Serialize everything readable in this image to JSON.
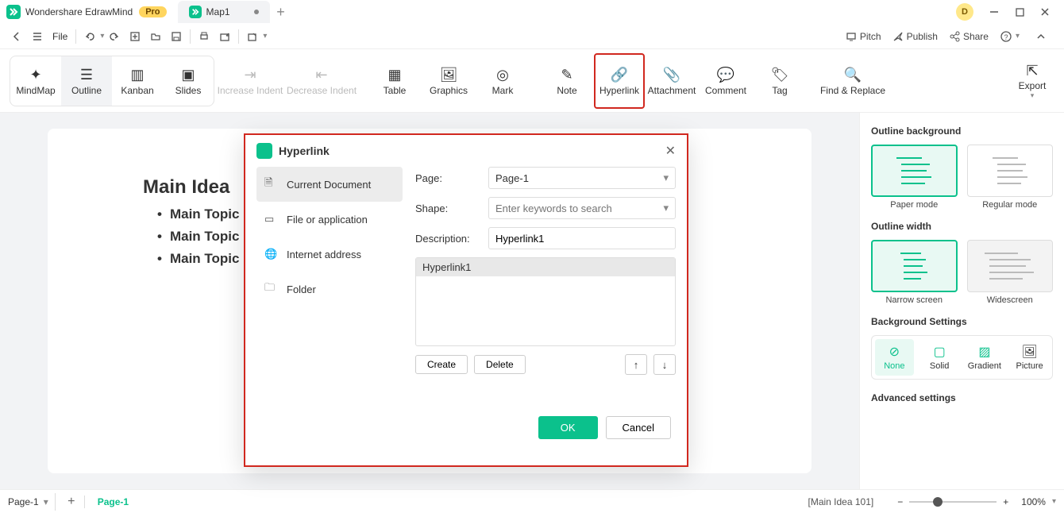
{
  "app": {
    "name": "Wondershare EdrawMind",
    "badge": "Pro",
    "user_initial": "D"
  },
  "tabs": {
    "active": "Map1"
  },
  "menu": {
    "file": "File"
  },
  "toolbar_right": {
    "pitch": "Pitch",
    "publish": "Publish",
    "share": "Share"
  },
  "ribbon": {
    "views": {
      "mindmap": "MindMap",
      "outline": "Outline",
      "kanban": "Kanban",
      "slides": "Slides"
    },
    "indent_in": "Increase Indent",
    "indent_out": "Decrease Indent",
    "table": "Table",
    "graphics": "Graphics",
    "mark": "Mark",
    "note": "Note",
    "hyperlink": "Hyperlink",
    "attachment": "Attachment",
    "comment": "Comment",
    "tag": "Tag",
    "find": "Find & Replace",
    "export": "Export"
  },
  "document": {
    "main_idea": "Main Idea",
    "topics": [
      "Main Topic",
      "Main Topic",
      "Main Topic"
    ]
  },
  "dialog": {
    "title": "Hyperlink",
    "nav": {
      "current": "Current Document",
      "file": "File or application",
      "internet": "Internet address",
      "folder": "Folder"
    },
    "labels": {
      "page": "Page:",
      "shape": "Shape:",
      "description": "Description:"
    },
    "page_value": "Page-1",
    "shape_placeholder": "Enter keywords to search",
    "description_value": "Hyperlink1",
    "list_item": "Hyperlink1",
    "create": "Create",
    "delete": "Delete",
    "ok": "OK",
    "cancel": "Cancel"
  },
  "side": {
    "outline_bg": "Outline background",
    "paper": "Paper mode",
    "regular": "Regular mode",
    "outline_width": "Outline width",
    "narrow": "Narrow screen",
    "wide": "Widescreen",
    "bg_settings": "Background Settings",
    "none": "None",
    "solid": "Solid",
    "gradient": "Gradient",
    "picture": "Picture",
    "advanced": "Advanced settings"
  },
  "status": {
    "page_select": "Page-1",
    "page_tab": "Page-1",
    "info": "[Main Idea 101]",
    "zoom": "100%"
  }
}
